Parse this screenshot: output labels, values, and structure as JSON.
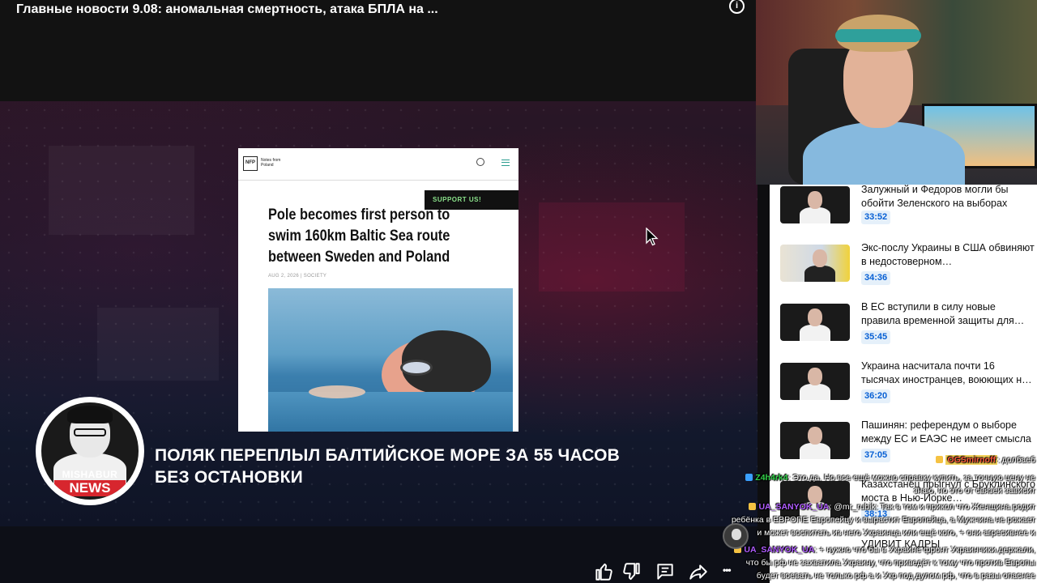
{
  "video": {
    "title": "Главные новости 9.08: аномальная смертность, атака БПЛА на ...",
    "info_icon": "info-icon",
    "article": {
      "logo_mark": "NFP",
      "logo_name": "Notes from Poland",
      "support_label": "SUPPORT US!",
      "headline": "Pole becomes first person to swim 160km Baltic Sea route between Sweden and Poland",
      "meta": "AUG 2, 2026 | SOCIETY"
    },
    "channel_logo": {
      "line1": "MISHABUR",
      "line2": "NEWS"
    },
    "lower_third": "ПОЛЯК ПЕРЕПЛЫЛ БАЛТИЙСКОЕ МОРЕ ЗА 55 ЧАСОВ БЕЗ ОСТАНОВКИ"
  },
  "sidebar": {
    "videos": [
      {
        "title": "Залужный и Федоров могли бы обойти Зеленского на выборах",
        "duration": "33:52",
        "thumb": "presenter"
      },
      {
        "title": "Экс-послу Украины в США обвиняют в недостоверном…",
        "duration": "34:36",
        "thumb": "flags"
      },
      {
        "title": "В ЕС вступили в силу новые правила временной защиты для…",
        "duration": "35:45",
        "thumb": "presenter"
      },
      {
        "title": "Украина насчитала почти 16 тысячах иностранцев, воюющих н…",
        "duration": "36:20",
        "thumb": "presenter"
      },
      {
        "title": "Пашинян: референдум о выборе между ЕС и ЕАЭС не имеет смысла",
        "duration": "37:05",
        "thumb": "presenter"
      },
      {
        "title": "Казахстанец прыгнул с Бруклинского моста в Нью-Йорке…",
        "duration": "38:13",
        "thumb": "presenter"
      }
    ],
    "partial_text": "УДИВИТ КАДРЫ"
  },
  "chat": {
    "messages": [
      {
        "nick": "OGSmirnoff",
        "text": ": долбаеб",
        "nick_color": "#ff5a3c",
        "badge_color": "#f5c242"
      },
      {
        "nick": "Z4h4rk4",
        "text": ": Это да. Но все ещё можно справку купить, за точную цену не",
        "nick_color": "#32d24a",
        "badge_color": "#3aa0ff"
      },
      {
        "nick": "",
        "text": "знаю, но это от связей зависит",
        "nick_color": "#ffffff",
        "badge_color": ""
      },
      {
        "nick": "UA_SANYOK_UA",
        "text": ": @mr_rubik: Так в том и прикол что Женщина родит",
        "nick_color": "#b05cff",
        "badge_color": "#f5c242"
      },
      {
        "nick": "",
        "text": "ребёнка в ЕВРОПЕ Европейцу и вырастит Европейца, а Мужчина не рожает",
        "nick_color": "#ffffff",
        "badge_color": ""
      },
      {
        "nick": "",
        "text": "и может воспитать из него Украинца или ещё кого, + они агресивнее и",
        "nick_color": "#ffffff",
        "badge_color": ""
      },
      {
        "nick": "UA_SANYOK_UA",
        "text": ": + нужно что бы в Украине фронт Украинчики держали,",
        "nick_color": "#b05cff",
        "badge_color": "#f5c242"
      },
      {
        "nick": "",
        "text": "что бы рф не захватила Украину, что приведёт к тому что против Европы",
        "nick_color": "#ffffff",
        "badge_color": ""
      },
      {
        "nick": "",
        "text": "будет воевать не только рф а и Укр под дулом рф, что в разы опаснее",
        "nick_color": "#ffffff",
        "badge_color": ""
      }
    ]
  },
  "actions": {
    "like_icon": "thumbs-up-icon",
    "dislike_icon": "thumbs-down-icon",
    "comment_icon": "comment-icon",
    "share_icon": "share-icon",
    "more_icon": "more-icon",
    "more_glyph": "•••"
  }
}
